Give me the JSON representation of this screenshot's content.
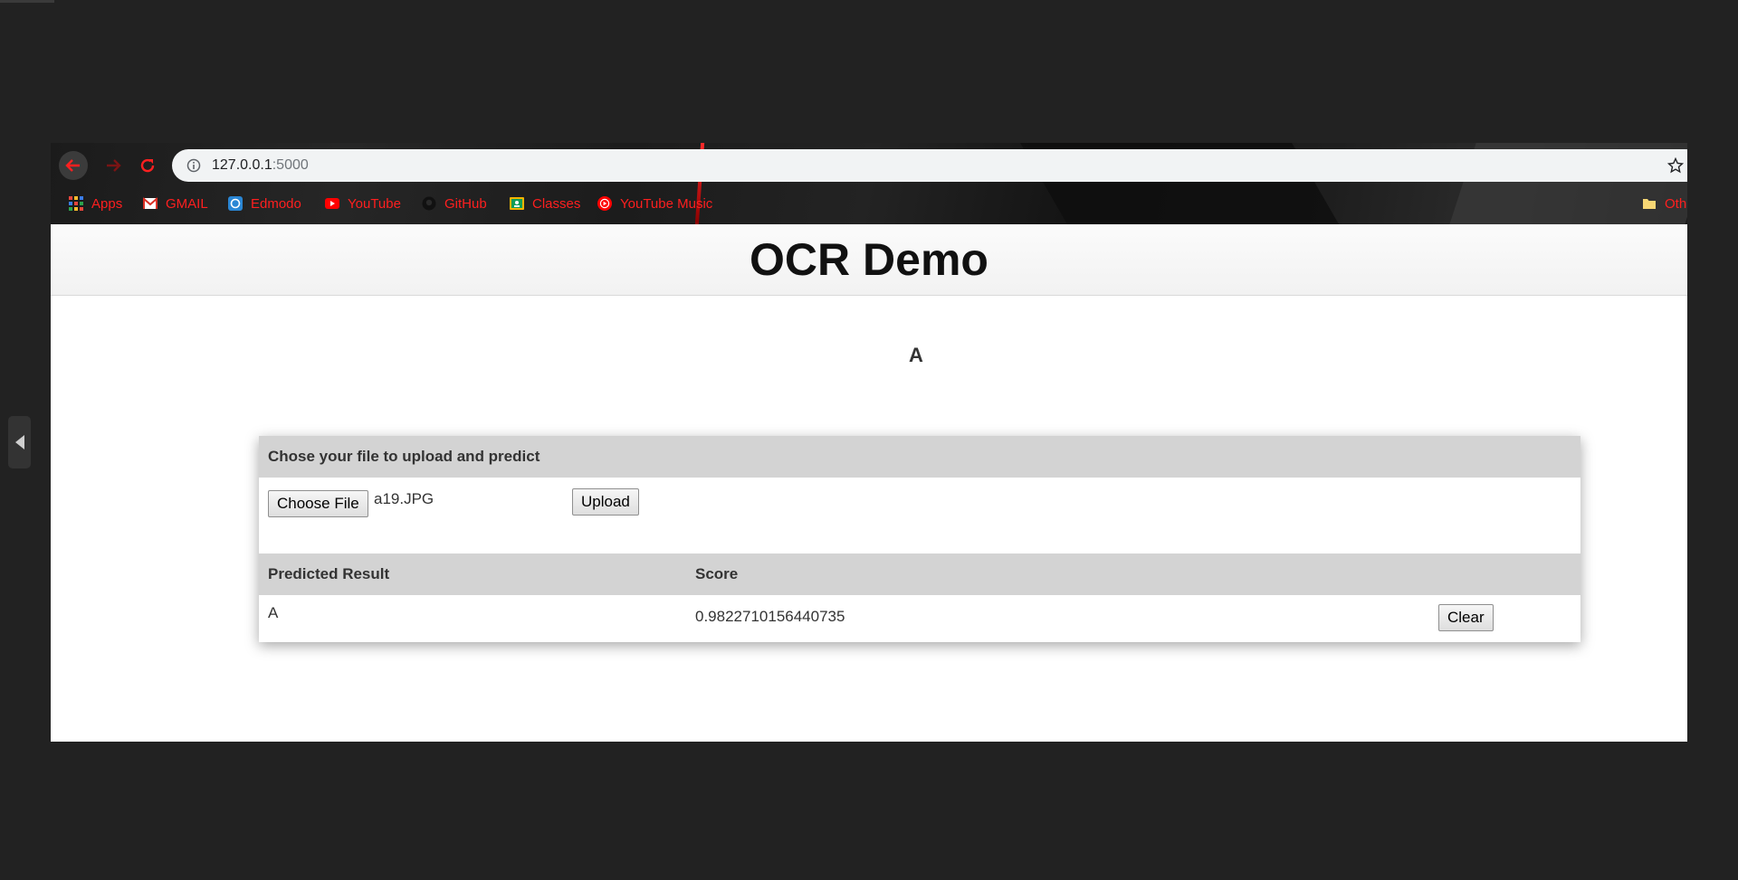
{
  "browser": {
    "url_host": "127.0.0.1",
    "url_port": ":5000",
    "bookmarks": [
      {
        "label": "Apps",
        "icon": "apps-grid-icon"
      },
      {
        "label": "GMAIL",
        "icon": "gmail-icon"
      },
      {
        "label": "Edmodo",
        "icon": "edmodo-icon"
      },
      {
        "label": "YouTube",
        "icon": "youtube-icon"
      },
      {
        "label": "GitHub",
        "icon": "github-icon"
      },
      {
        "label": "Classes",
        "icon": "classes-icon"
      },
      {
        "label": "YouTube Music",
        "icon": "youtube-music-icon"
      },
      {
        "label": "Oth",
        "icon": "folder-icon"
      }
    ],
    "accent_color": "#ff1f1f"
  },
  "page": {
    "title": "OCR Demo",
    "predicted_letter": "A",
    "upload_card": {
      "heading": "Chose your file to upload and predict",
      "choose_file_label": "Choose File",
      "selected_file": "a19.JPG",
      "upload_label": "Upload"
    },
    "results": {
      "columns": [
        "Predicted Result",
        "Score"
      ],
      "rows": [
        {
          "predicted": "A",
          "score": "0.9822710156440735"
        }
      ],
      "clear_label": "Clear"
    }
  }
}
